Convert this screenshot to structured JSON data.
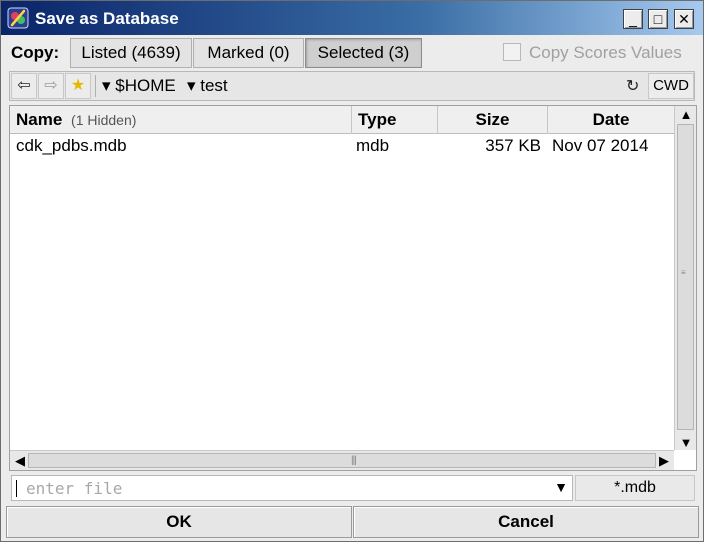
{
  "window": {
    "title": "Save as Database",
    "app_icon": "palette-icon",
    "controls": {
      "minimize": "_",
      "maximize": "□",
      "close": "✕"
    }
  },
  "copy_bar": {
    "label": "Copy:",
    "options": [
      {
        "label": "Listed (4639)",
        "selected": false
      },
      {
        "label": "Marked (0)",
        "selected": false
      },
      {
        "label": "Selected (3)",
        "selected": true
      }
    ],
    "scores_checkbox": {
      "label": "Copy Scores Values",
      "checked": false,
      "enabled": false
    }
  },
  "path_bar": {
    "back_icon": "⇦",
    "forward_icon": "⇨",
    "favorite_icon": "★",
    "crumbs": [
      "▾ $HOME",
      "▾ test"
    ],
    "refresh_icon": "↻",
    "cwd_label": "CWD"
  },
  "file_list": {
    "columns": {
      "name": "Name",
      "hidden_count": "(1 Hidden)",
      "type": "Type",
      "size": "Size",
      "date": "Date"
    },
    "rows": [
      {
        "name": "cdk_pdbs.mdb",
        "type": "mdb",
        "size": "357 KB",
        "date": "Nov 07 2014"
      }
    ]
  },
  "file_entry": {
    "placeholder": "enter file",
    "value": "",
    "dropdown_icon": "▼",
    "filter_label": "*.mdb"
  },
  "buttons": {
    "ok": "OK",
    "cancel": "Cancel"
  }
}
